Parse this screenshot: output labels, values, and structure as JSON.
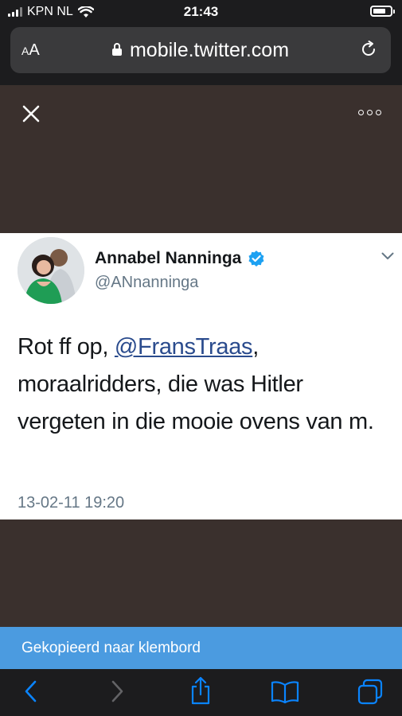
{
  "status": {
    "carrier": "KPN NL",
    "time": "21:43",
    "battery_level": 0.75
  },
  "browser": {
    "text_size_label_small": "A",
    "text_size_label_large": "A",
    "url": "mobile.twitter.com"
  },
  "tweet": {
    "name": "Annabel Nanninga",
    "handle": "@ANnanninga",
    "text_before": "Rot ff op, ",
    "mention": "@FransTraas",
    "text_after": ", moraalridders, die was Hitler vergeten in die mooie ovens van m.",
    "date": "13-02-11 19:20"
  },
  "toast": {
    "message": "Gekopieerd naar klembord"
  },
  "colors": {
    "accent": "#0a84ff",
    "toast_bg": "#4b9be0",
    "verified": "#1da1f2",
    "overlay": "#3a302d"
  },
  "icons": [
    "close-icon",
    "more-icon",
    "lock-icon",
    "reload-icon",
    "verified-icon",
    "chevron-down-icon",
    "back-icon",
    "forward-icon",
    "share-icon",
    "bookmarks-icon",
    "tabs-icon"
  ]
}
